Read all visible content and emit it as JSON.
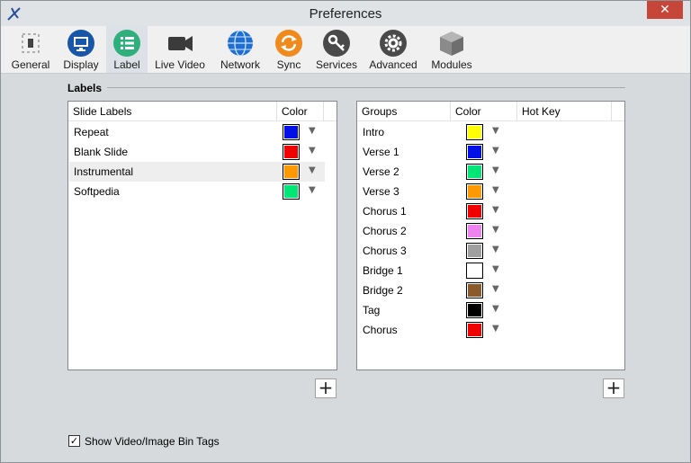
{
  "window": {
    "title": "Preferences",
    "close_glyph": "✕"
  },
  "toolbar": [
    {
      "id": "general",
      "label": "General",
      "icon": "general-icon"
    },
    {
      "id": "display",
      "label": "Display",
      "icon": "display-icon"
    },
    {
      "id": "label",
      "label": "Label",
      "icon": "label-icon",
      "selected": true
    },
    {
      "id": "live-video",
      "label": "Live Video",
      "icon": "video-camera-icon"
    },
    {
      "id": "network",
      "label": "Network",
      "icon": "globe-icon"
    },
    {
      "id": "sync",
      "label": "Sync",
      "icon": "sync-icon"
    },
    {
      "id": "services",
      "label": "Services",
      "icon": "key-icon"
    },
    {
      "id": "advanced",
      "label": "Advanced",
      "icon": "gear-icon"
    },
    {
      "id": "modules",
      "label": "Modules",
      "icon": "cube-icon"
    }
  ],
  "labels_section": {
    "title": "Labels"
  },
  "slide_labels": {
    "headers": {
      "name": "Slide Labels",
      "color": "Color"
    },
    "rows": [
      {
        "name": "Repeat",
        "color": "#0010e6"
      },
      {
        "name": "Blank Slide",
        "color": "#f00000"
      },
      {
        "name": "Instrumental",
        "color": "#ff9900",
        "highlighted": true
      },
      {
        "name": "Softpedia",
        "color": "#00e676"
      }
    ],
    "add_glyph": "+"
  },
  "groups": {
    "headers": {
      "name": "Groups",
      "color": "Color",
      "hotkey": "Hot Key"
    },
    "rows": [
      {
        "name": "Intro",
        "color": "#ffff00"
      },
      {
        "name": "Verse 1",
        "color": "#0010e6"
      },
      {
        "name": "Verse 2",
        "color": "#00e676"
      },
      {
        "name": "Verse 3",
        "color": "#ff9900"
      },
      {
        "name": "Chorus 1",
        "color": "#f00000"
      },
      {
        "name": "Chorus 2",
        "color": "#ee82ee"
      },
      {
        "name": "Chorus 3",
        "color": "#a0a0a0"
      },
      {
        "name": "Bridge 1",
        "color": "#ffffff"
      },
      {
        "name": "Bridge 2",
        "color": "#8b5a2b"
      },
      {
        "name": "Tag",
        "color": "#000000"
      },
      {
        "name": "Chorus",
        "color": "#f00000"
      }
    ],
    "add_glyph": "+"
  },
  "dropdown_glyph": "▼",
  "show_bin_tags": {
    "label": "Show Video/Image Bin Tags",
    "checked": true,
    "check_glyph": "✓"
  }
}
